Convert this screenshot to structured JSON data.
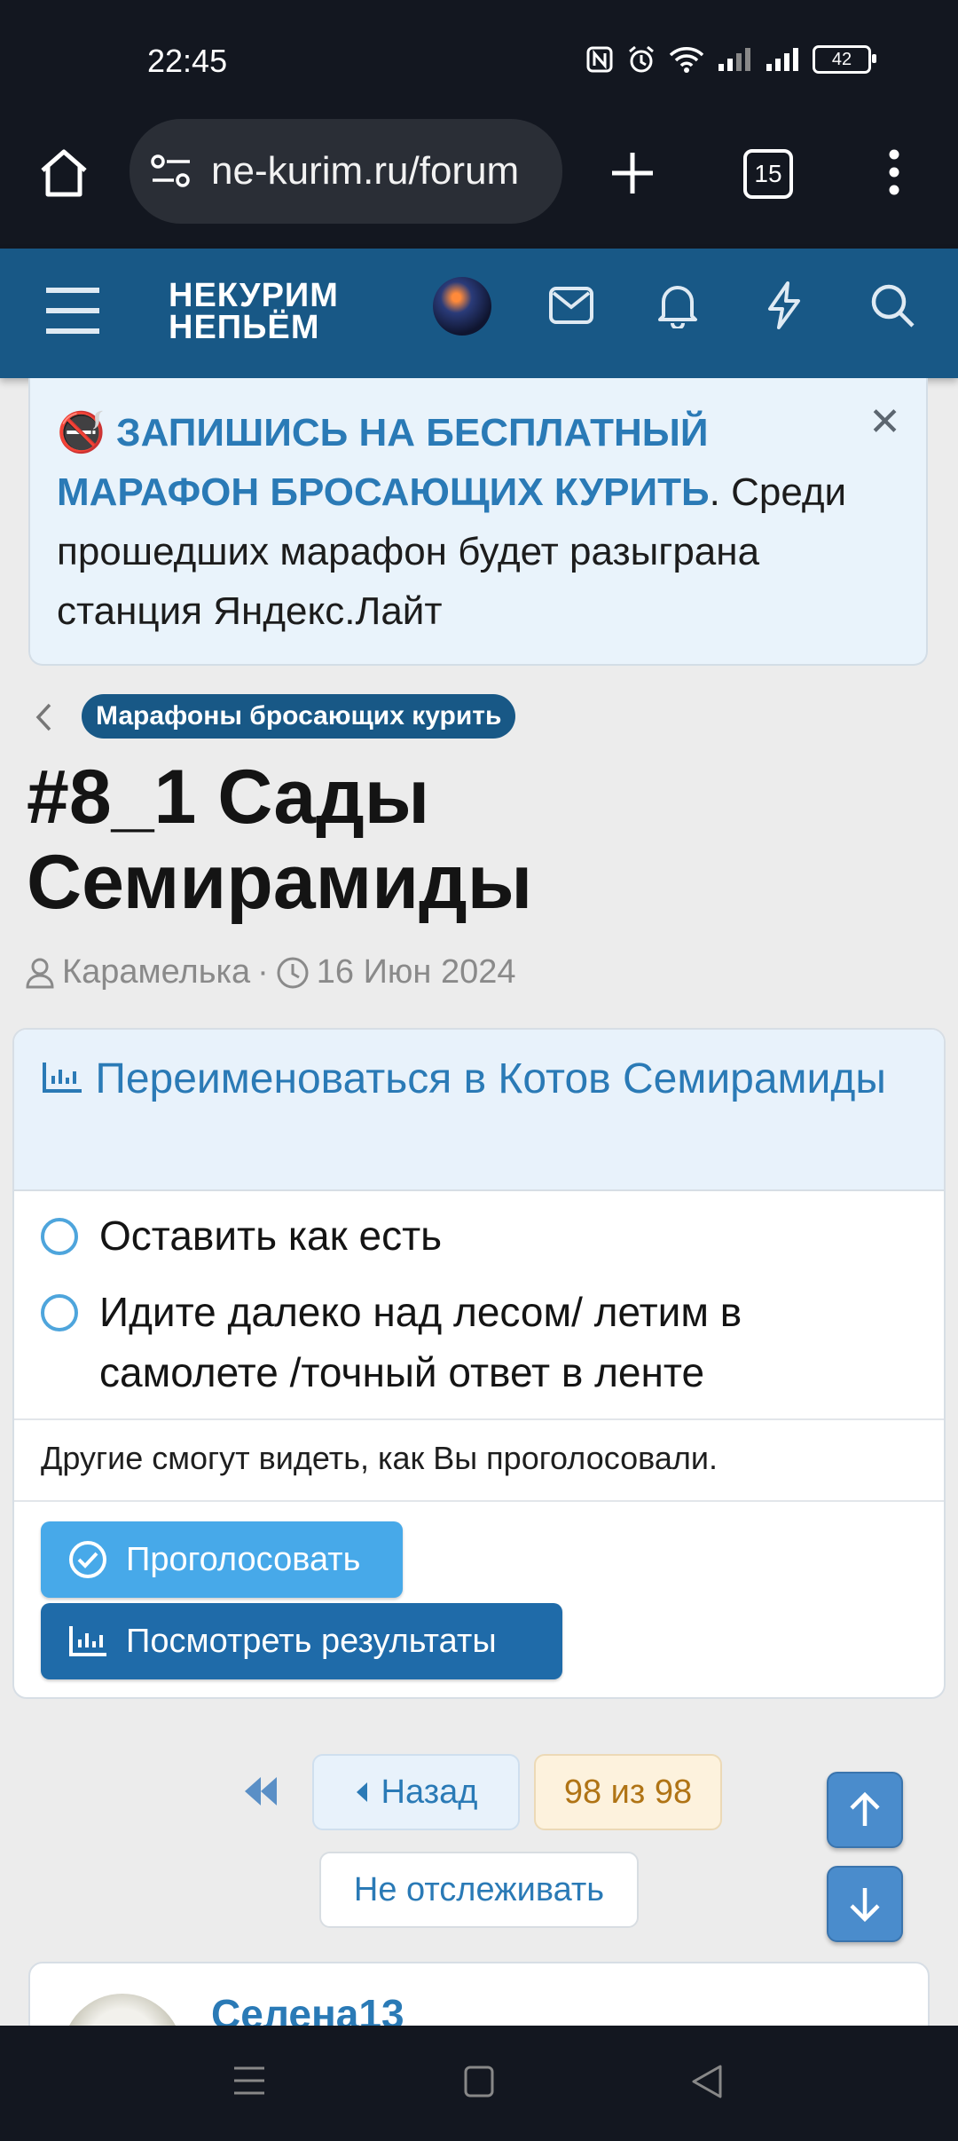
{
  "status_bar": {
    "time": "22:45",
    "battery": "42"
  },
  "browser": {
    "url": "ne-kurim.ru/forum",
    "tab_count": "15"
  },
  "site": {
    "logo_line1": "НЕКУРИМ",
    "logo_line2": "НЕПЬЁМ"
  },
  "notice": {
    "emoji": "🚭",
    "link_text": "ЗАПИШИСЬ НА БЕСПЛАТНЫЙ МАРАФОН БРОСАЮЩИХ КУРИТЬ",
    "rest_text": ". Среди прошедших марафон будет разыграна станция Яндекс.Лайт",
    "close": "✕"
  },
  "breadcrumb": {
    "forum": "Марафоны бросающих курить"
  },
  "thread": {
    "title": "#8_1 Сады Семирамиды",
    "author": "Карамелька",
    "separator": "·",
    "date": "16 Июн 2024"
  },
  "poll": {
    "question": "Переименоваться в Котов Семирамиды",
    "options": [
      "Оставить как есть",
      "Идите далеко над лесом/ летим в самолете /точный ответ в ленте"
    ],
    "note": "Другие смогут видеть, как Вы проголосовали.",
    "vote_label": "Проголосовать",
    "results_label": "Посмотреть результаты"
  },
  "pagination": {
    "back_label": "Назад",
    "page_status": "98 из 98",
    "unwatch_label": "Не отслеживать"
  },
  "next_post": {
    "author": "Селена13"
  },
  "colors": {
    "header": "#185886",
    "accent": "#2a7ab6",
    "vote": "#47a9e9",
    "results": "#1f6ba9"
  }
}
